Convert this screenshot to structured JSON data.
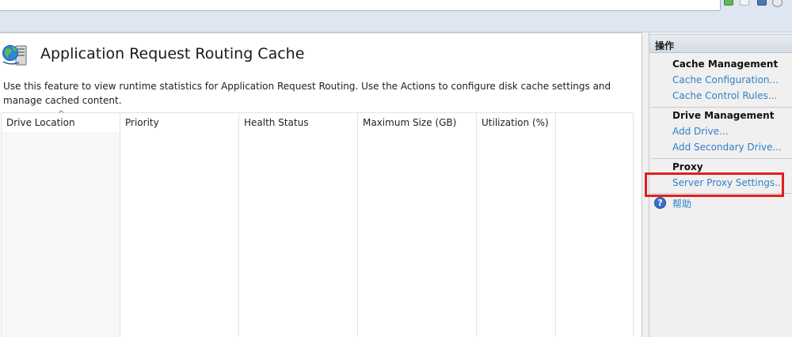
{
  "page": {
    "title": "Application Request Routing Cache",
    "description": "Use this feature to view runtime statistics for Application Request Routing.  Use the Actions to configure disk cache settings and manage cached content."
  },
  "table": {
    "columns": [
      "Drive Location",
      "Priority",
      "Health Status",
      "Maximum Size (GB)",
      "Utilization (%)",
      ""
    ],
    "sort_indicator": "^",
    "rows": []
  },
  "actions": {
    "header": "操作",
    "sections": [
      {
        "title": "Cache Management",
        "links": [
          "Cache Configuration...",
          "Cache Control Rules..."
        ]
      },
      {
        "title": "Drive Management",
        "links": [
          "Add Drive...",
          "Add Secondary Drive..."
        ]
      },
      {
        "title": "Proxy",
        "links": [
          "Server Proxy Settings..."
        ]
      }
    ],
    "help_label": "帮助",
    "help_icon_glyph": "?"
  },
  "icons": {
    "feature": "globe-server-icon",
    "help": "help-icon"
  },
  "colors": {
    "link": "#2f7fc8",
    "highlight": "#e02020"
  }
}
